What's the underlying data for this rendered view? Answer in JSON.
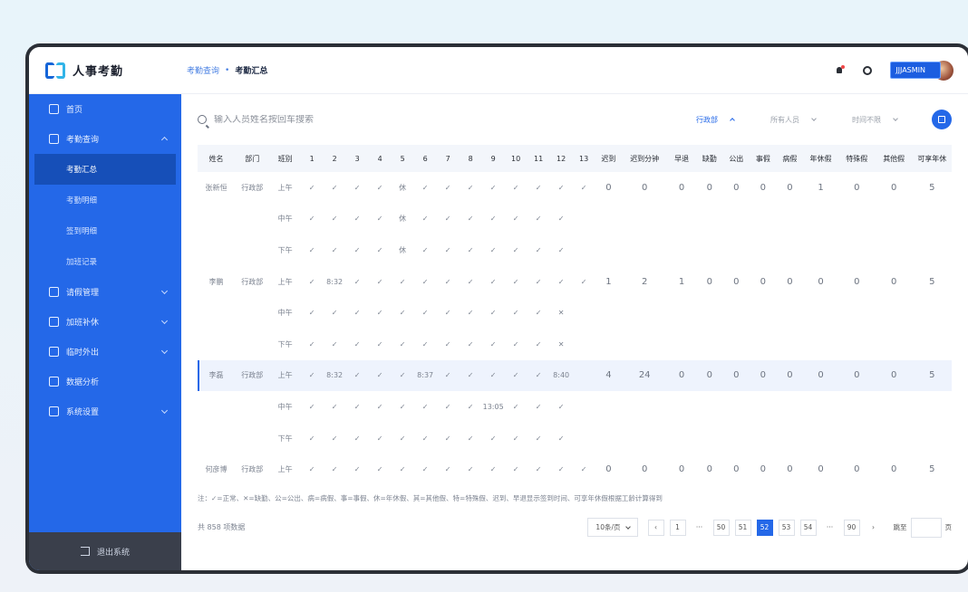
{
  "app": {
    "name": "人事考勤"
  },
  "breadcrumb": {
    "parent": "考勤查询",
    "separator": "•",
    "current": "考勤汇总"
  },
  "header": {
    "user": "JJJASMIN"
  },
  "sidebar": {
    "items": [
      {
        "label": "首页"
      },
      {
        "label": "考勤查询",
        "children": [
          "考勤汇总",
          "考勤明细",
          "签到明细",
          "加班记录"
        ]
      },
      {
        "label": "请假管理"
      },
      {
        "label": "加班补休"
      },
      {
        "label": "临时外出"
      },
      {
        "label": "数据分析"
      },
      {
        "label": "系统设置"
      }
    ],
    "logout": "退出系统"
  },
  "search": {
    "placeholder": "输入人员姓名按回车搜索"
  },
  "filters": {
    "dept": "行政部",
    "people": "所有人员",
    "time": "时间不限"
  },
  "table": {
    "headers": [
      "姓名",
      "部门",
      "班别",
      "1",
      "2",
      "3",
      "4",
      "5",
      "6",
      "7",
      "8",
      "9",
      "10",
      "11",
      "12",
      "13",
      "迟到",
      "迟到分钟",
      "早退",
      "缺勤",
      "公出",
      "事假",
      "病假",
      "年休假",
      "特殊假",
      "其他假",
      "可享年休"
    ],
    "rows": [
      {
        "name": "张新恒",
        "dept": "行政部",
        "shift": "上午",
        "days": [
          "✓",
          "✓",
          "✓",
          "✓",
          "休",
          "✓",
          "✓",
          "✓",
          "✓",
          "✓",
          "✓",
          "✓",
          "✓"
        ],
        "stats": [
          "0",
          "0",
          "0",
          "0",
          "0",
          "0",
          "0",
          "1",
          "0",
          "0",
          "5"
        ]
      },
      {
        "name": "",
        "dept": "",
        "shift": "中午",
        "days": [
          "✓",
          "✓",
          "✓",
          "✓",
          "休",
          "✓",
          "✓",
          "✓",
          "✓",
          "✓",
          "✓",
          "✓",
          ""
        ],
        "stats": []
      },
      {
        "name": "",
        "dept": "",
        "shift": "下午",
        "days": [
          "✓",
          "✓",
          "✓",
          "✓",
          "休",
          "✓",
          "✓",
          "✓",
          "✓",
          "✓",
          "✓",
          "✓",
          ""
        ],
        "stats": []
      },
      {
        "name": "李鹏",
        "dept": "行政部",
        "shift": "上午",
        "days": [
          "✓",
          "8:32",
          "✓",
          "✓",
          "✓",
          "✓",
          "✓",
          "✓",
          "✓",
          "✓",
          "✓",
          "✓",
          "✓"
        ],
        "stats": [
          "1",
          "2",
          "1",
          "0",
          "0",
          "0",
          "0",
          "0",
          "0",
          "0",
          "5"
        ]
      },
      {
        "name": "",
        "dept": "",
        "shift": "中午",
        "days": [
          "✓",
          "✓",
          "✓",
          "✓",
          "✓",
          "✓",
          "✓",
          "✓",
          "✓",
          "✓",
          "✓",
          "✕",
          ""
        ],
        "stats": []
      },
      {
        "name": "",
        "dept": "",
        "shift": "下午",
        "days": [
          "✓",
          "✓",
          "✓",
          "✓",
          "✓",
          "✓",
          "✓",
          "✓",
          "✓",
          "✓",
          "✓",
          "✕",
          ""
        ],
        "stats": []
      },
      {
        "name": "李磊",
        "dept": "行政部",
        "shift": "上午",
        "days": [
          "✓",
          "8:32",
          "✓",
          "✓",
          "✓",
          "8:37",
          "✓",
          "✓",
          "✓",
          "✓",
          "✓",
          "8:40",
          ""
        ],
        "stats": [
          "4",
          "24",
          "0",
          "0",
          "0",
          "0",
          "0",
          "0",
          "0",
          "0",
          "5"
        ],
        "highlight": true
      },
      {
        "name": "",
        "dept": "",
        "shift": "中午",
        "days": [
          "✓",
          "✓",
          "✓",
          "✓",
          "✓",
          "✓",
          "✓",
          "✓",
          "13:05",
          "✓",
          "✓",
          "✓",
          ""
        ],
        "stats": []
      },
      {
        "name": "",
        "dept": "",
        "shift": "下午",
        "days": [
          "✓",
          "✓",
          "✓",
          "✓",
          "✓",
          "✓",
          "✓",
          "✓",
          "✓",
          "✓",
          "✓",
          "✓",
          ""
        ],
        "stats": []
      },
      {
        "name": "何彦博",
        "dept": "行政部",
        "shift": "上午",
        "days": [
          "✓",
          "✓",
          "✓",
          "✓",
          "✓",
          "✓",
          "✓",
          "✓",
          "✓",
          "✓",
          "✓",
          "✓",
          "✓"
        ],
        "stats": [
          "0",
          "0",
          "0",
          "0",
          "0",
          "0",
          "0",
          "0",
          "0",
          "0",
          "5"
        ]
      }
    ]
  },
  "note": "注：✓=正常、✕=缺勤、公=公出、病=病假、事=事假、休=年休假、其=其他假、特=特殊假、迟到、早退显示签到时间、可享年休假根据工龄计算得到",
  "pagination": {
    "total": "共 858 项数据",
    "page_size": "10条/页",
    "pages": [
      "1",
      "···",
      "50",
      "51",
      "52",
      "53",
      "54",
      "···",
      "90"
    ],
    "active": "52",
    "jump_label": "跳至",
    "jump_suffix": "页"
  },
  "colors": {
    "primary": "#2468e8",
    "sidebar_dark": "#164fb8",
    "footer": "#3a3f4b"
  }
}
